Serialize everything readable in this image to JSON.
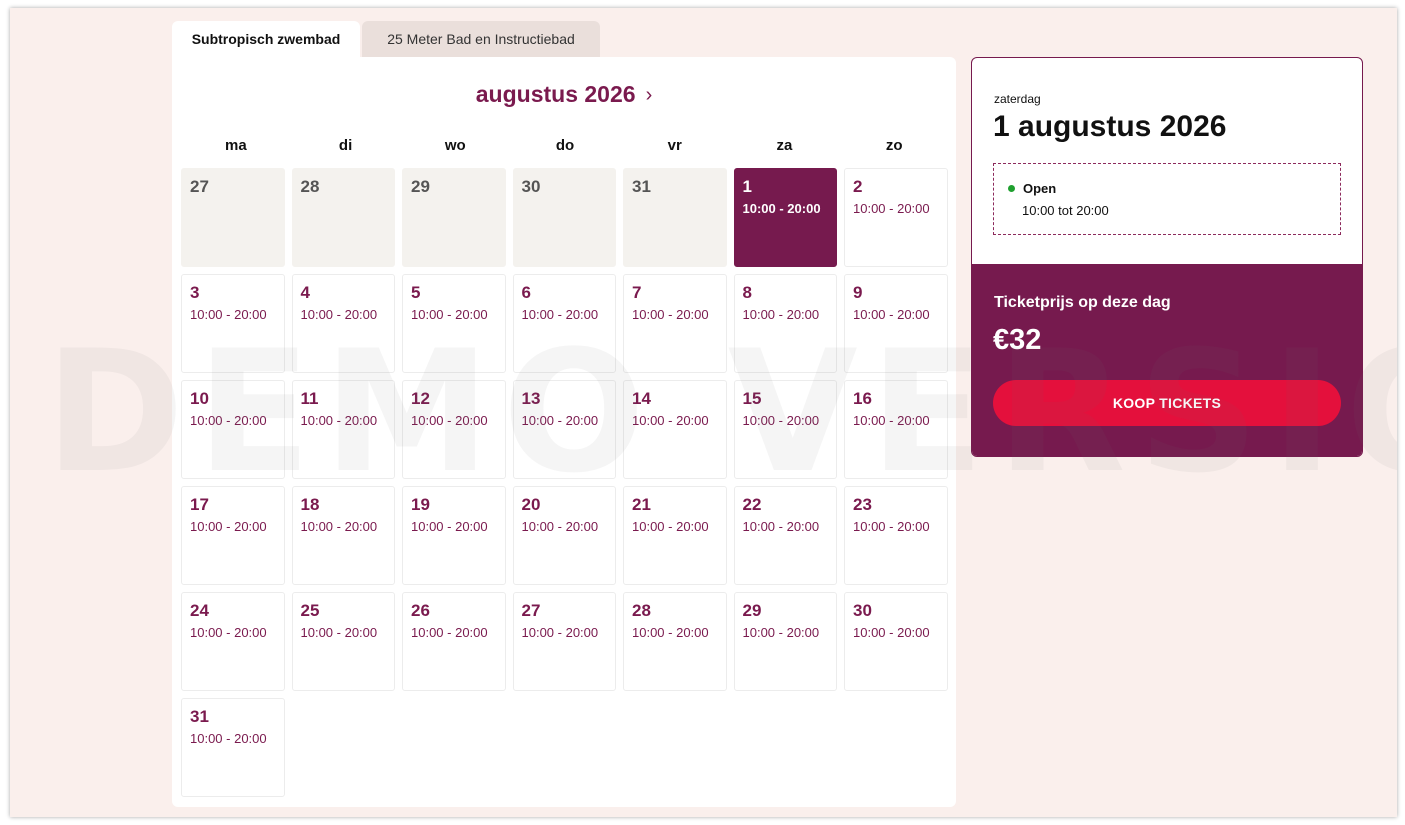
{
  "watermark": "DEMO VERSION",
  "tabs": [
    {
      "label": "Subtropisch zwembad",
      "active": true
    },
    {
      "label": "25 Meter Bad en Instructiebad",
      "active": false
    }
  ],
  "calendar": {
    "month_title": "augustus 2026",
    "next_icon": "chevron-right-icon",
    "weekdays": [
      "ma",
      "di",
      "wo",
      "do",
      "vr",
      "za",
      "zo"
    ],
    "days": [
      {
        "num": "27",
        "time": "",
        "state": "past"
      },
      {
        "num": "28",
        "time": "",
        "state": "past"
      },
      {
        "num": "29",
        "time": "",
        "state": "past"
      },
      {
        "num": "30",
        "time": "",
        "state": "past"
      },
      {
        "num": "31",
        "time": "",
        "state": "past"
      },
      {
        "num": "1",
        "time": "10:00 - 20:00",
        "state": "selected"
      },
      {
        "num": "2",
        "time": "10:00 - 20:00",
        "state": "open"
      },
      {
        "num": "3",
        "time": "10:00 - 20:00",
        "state": "open"
      },
      {
        "num": "4",
        "time": "10:00 - 20:00",
        "state": "open"
      },
      {
        "num": "5",
        "time": "10:00 - 20:00",
        "state": "open"
      },
      {
        "num": "6",
        "time": "10:00 - 20:00",
        "state": "open"
      },
      {
        "num": "7",
        "time": "10:00 - 20:00",
        "state": "open"
      },
      {
        "num": "8",
        "time": "10:00 - 20:00",
        "state": "open"
      },
      {
        "num": "9",
        "time": "10:00 - 20:00",
        "state": "open"
      },
      {
        "num": "10",
        "time": "10:00 - 20:00",
        "state": "open"
      },
      {
        "num": "11",
        "time": "10:00 - 20:00",
        "state": "open"
      },
      {
        "num": "12",
        "time": "10:00 - 20:00",
        "state": "open"
      },
      {
        "num": "13",
        "time": "10:00 - 20:00",
        "state": "open"
      },
      {
        "num": "14",
        "time": "10:00 - 20:00",
        "state": "open"
      },
      {
        "num": "15",
        "time": "10:00 - 20:00",
        "state": "open"
      },
      {
        "num": "16",
        "time": "10:00 - 20:00",
        "state": "open"
      },
      {
        "num": "17",
        "time": "10:00 - 20:00",
        "state": "open"
      },
      {
        "num": "18",
        "time": "10:00 - 20:00",
        "state": "open"
      },
      {
        "num": "19",
        "time": "10:00 - 20:00",
        "state": "open"
      },
      {
        "num": "20",
        "time": "10:00 - 20:00",
        "state": "open"
      },
      {
        "num": "21",
        "time": "10:00 - 20:00",
        "state": "open"
      },
      {
        "num": "22",
        "time": "10:00 - 20:00",
        "state": "open"
      },
      {
        "num": "23",
        "time": "10:00 - 20:00",
        "state": "open"
      },
      {
        "num": "24",
        "time": "10:00 - 20:00",
        "state": "open"
      },
      {
        "num": "25",
        "time": "10:00 - 20:00",
        "state": "open"
      },
      {
        "num": "26",
        "time": "10:00 - 20:00",
        "state": "open"
      },
      {
        "num": "27",
        "time": "10:00 - 20:00",
        "state": "open"
      },
      {
        "num": "28",
        "time": "10:00 - 20:00",
        "state": "open"
      },
      {
        "num": "29",
        "time": "10:00 - 20:00",
        "state": "open"
      },
      {
        "num": "30",
        "time": "10:00 - 20:00",
        "state": "open"
      },
      {
        "num": "31",
        "time": "10:00 - 20:00",
        "state": "open"
      }
    ]
  },
  "panel": {
    "day_name": "zaterdag",
    "full_date": "1 augustus 2026",
    "status": "Open",
    "status_color": "#1fa02f",
    "hours": "10:00 tot 20:00",
    "price_label": "Ticketprijs op deze dag",
    "price": "€32",
    "buy_label": "KOOP TICKETS"
  },
  "colors": {
    "brand": "#761a4e",
    "cta": "#e4103c",
    "page_bg": "#faefec"
  }
}
